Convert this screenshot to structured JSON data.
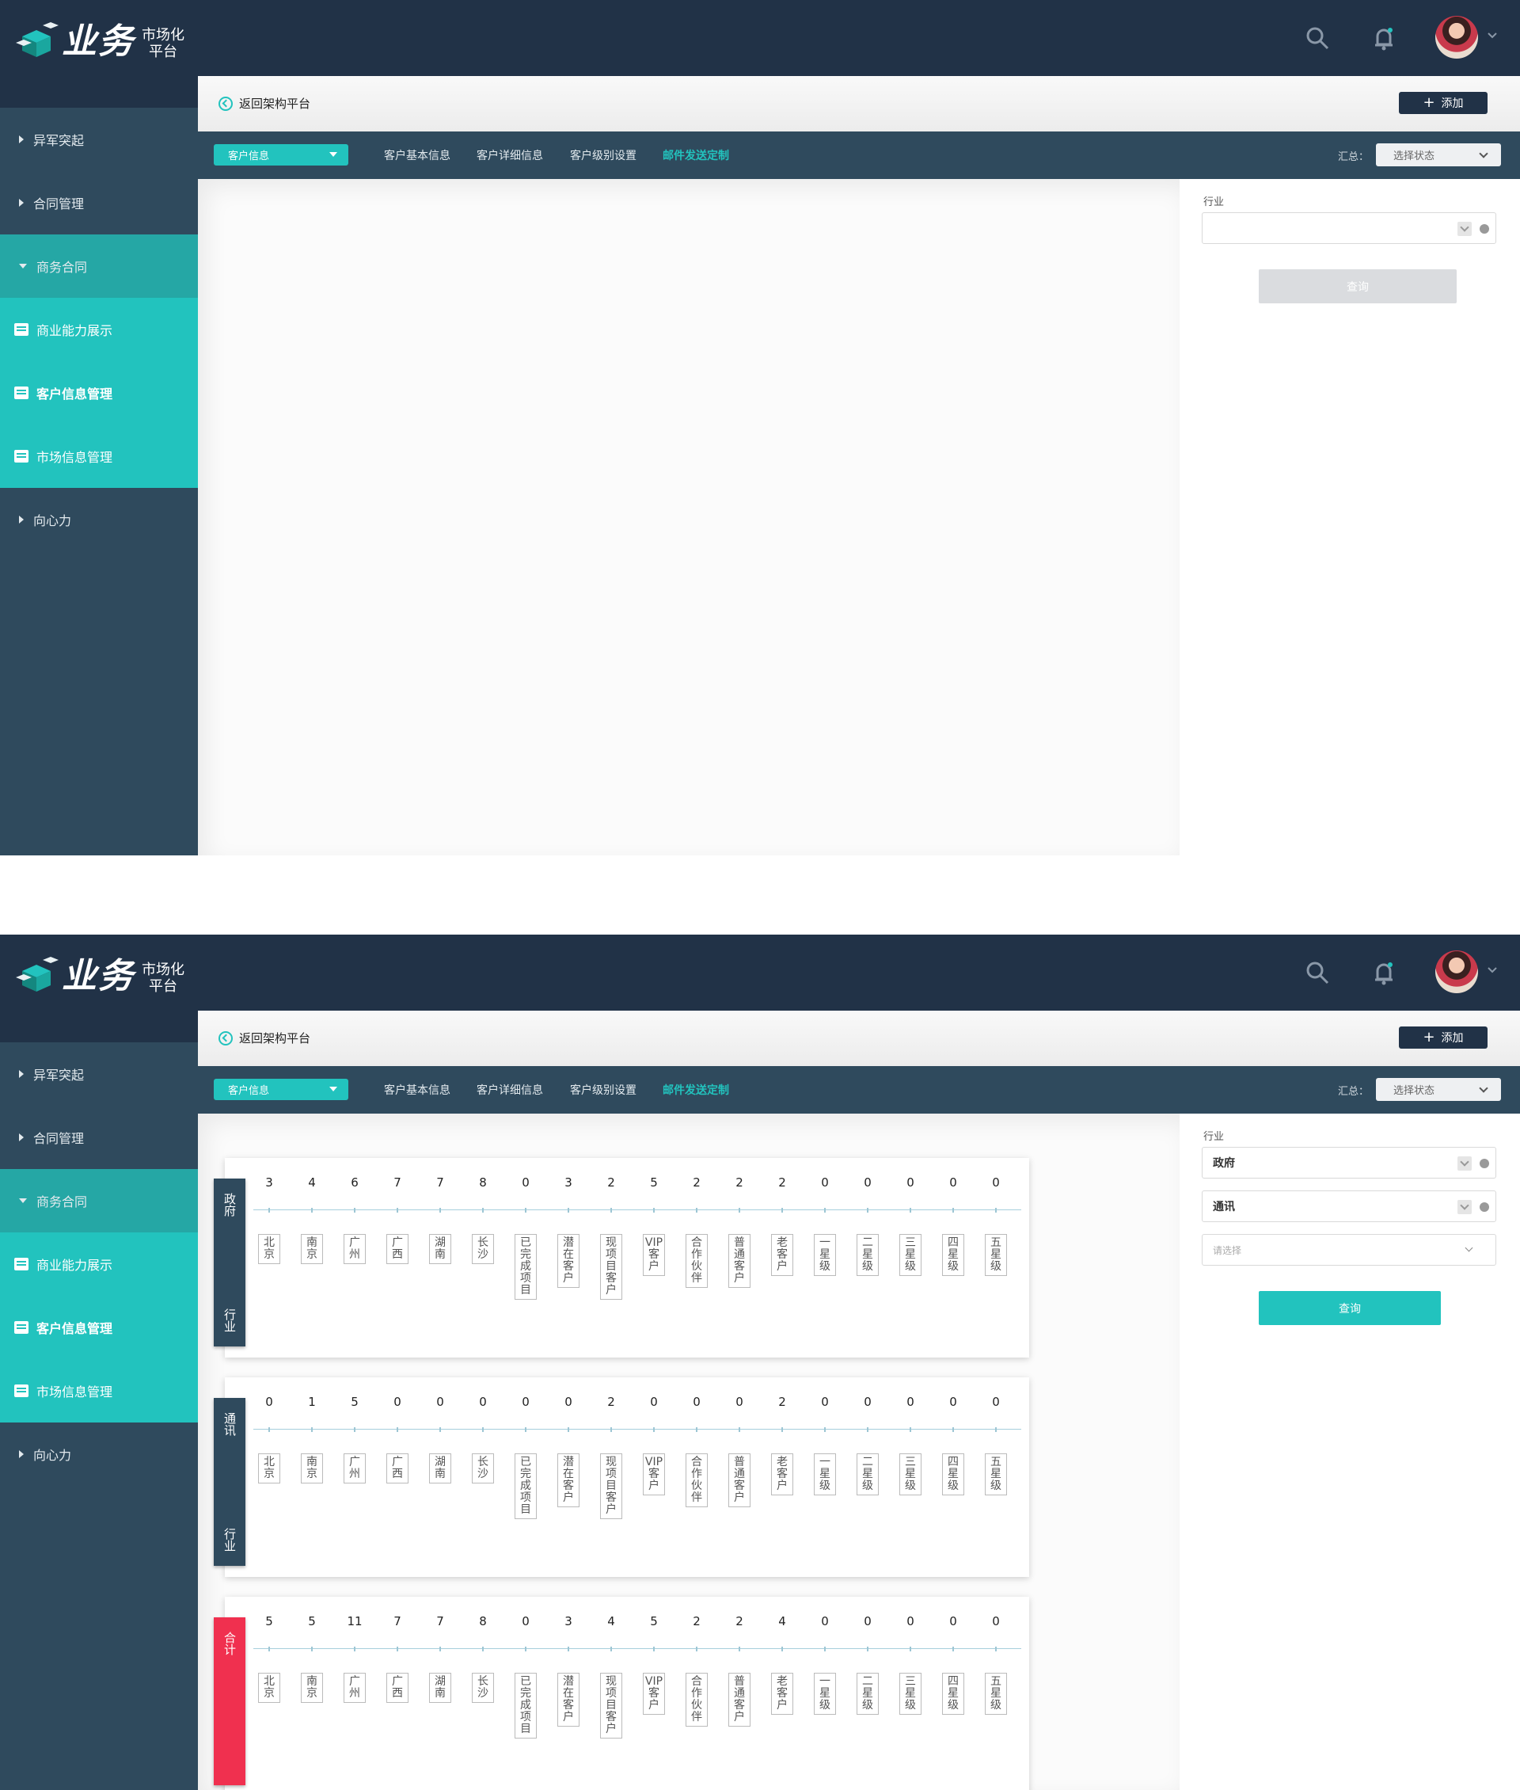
{
  "app": {
    "logo_main": "业务",
    "logo_sub_1": "市场化",
    "logo_sub_2": "平台"
  },
  "header": {
    "icons": [
      "search-icon",
      "bell-icon",
      "avatar",
      "chevron-down-icon"
    ]
  },
  "sidebar": {
    "items": [
      {
        "label": "异军突起",
        "type": "collapsed"
      },
      {
        "label": "合同管理",
        "type": "collapsed"
      },
      {
        "label": "商务合同",
        "type": "expanded"
      },
      {
        "label": "商业能力展示",
        "type": "sub",
        "icon": "server-icon"
      },
      {
        "label": "客户信息管理",
        "type": "sub-active",
        "icon": "id-card-icon"
      },
      {
        "label": "市场信息管理",
        "type": "sub",
        "icon": "monitor-icon"
      },
      {
        "label": "向心力",
        "type": "collapsed"
      }
    ]
  },
  "toolbar": {
    "back_label": "返回架构平台",
    "add_label": "添加"
  },
  "tabs": {
    "select_label": "客户信息",
    "items": [
      "客户基本信息",
      "客户详细信息",
      "客户级别设置",
      "邮件发送定制"
    ],
    "active_index": 3,
    "summary_label": "汇总：",
    "status_placeholder": "选择状态"
  },
  "filter": {
    "label": "行业",
    "query_label": "查询",
    "screen2_values": [
      "政府",
      "通讯"
    ],
    "screen2_placeholder": "请选择"
  },
  "columns": [
    "北京",
    "南京",
    "广州",
    "广西",
    "湖南",
    "长沙",
    "已完成项目",
    "潜在客户",
    "现项目客户",
    "VIP客户",
    "合作伙伴",
    "普通客户",
    "老客户",
    "一星级",
    "二星级",
    "三星级",
    "四星级",
    "五星级"
  ],
  "cards": [
    {
      "tab_top": "政府",
      "tab_bottom": "行业",
      "values": [
        "3",
        "4",
        "6",
        "7",
        "7",
        "8",
        "0",
        "3",
        "2",
        "5",
        "2",
        "2",
        "2",
        "0",
        "0",
        "0",
        "0",
        "0"
      ]
    },
    {
      "tab_top": "通讯",
      "tab_bottom": "行业",
      "values": [
        "0",
        "1",
        "5",
        "0",
        "0",
        "0",
        "0",
        "0",
        "2",
        "0",
        "0",
        "0",
        "2",
        "0",
        "0",
        "0",
        "0",
        "0"
      ]
    },
    {
      "tab_top": "合计",
      "tab_bottom": "",
      "values": [
        "5",
        "5",
        "11",
        "7",
        "7",
        "8",
        "0",
        "3",
        "4",
        "5",
        "2",
        "2",
        "4",
        "0",
        "0",
        "0",
        "0",
        "0"
      ],
      "accent": "#f0304f"
    }
  ],
  "colors": {
    "header": "#213247",
    "sidebar": "#2f4a5d",
    "accent": "#22c3be",
    "total": "#f0304f"
  }
}
